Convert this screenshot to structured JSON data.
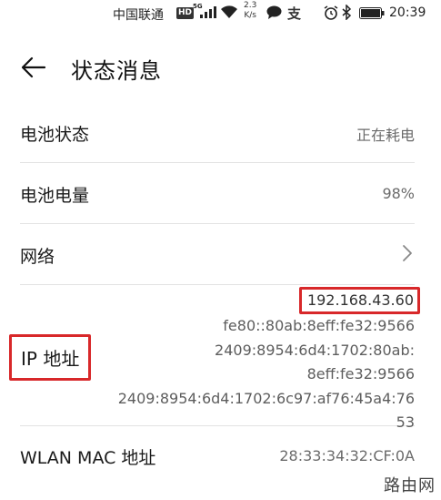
{
  "status_bar": {
    "carrier": "中国联通",
    "hd_badge": "HD",
    "network_gen": "5G",
    "speed_value": "2.3",
    "speed_unit": "K/s",
    "time": "20:39",
    "icons": [
      "signal-bars-icon",
      "wifi-icon",
      "message-bubble-icon",
      "alipay-icon",
      "alarm-icon",
      "bluetooth-icon",
      "battery-icon"
    ]
  },
  "header": {
    "title": "状态消息",
    "back_icon": "arrow-left-icon"
  },
  "rows": {
    "battery_status": {
      "label": "电池状态",
      "value": "正在耗电"
    },
    "battery_level": {
      "label": "电池电量",
      "value": "98%"
    },
    "network": {
      "label": "网络",
      "chevron_icon": "chevron-right-icon"
    },
    "ip": {
      "label": "IP 地址",
      "values": [
        "192.168.43.60",
        "fe80::80ab:8eff:fe32:9566",
        "2409:8954:6d4:1702:80ab:",
        "8eff:fe32:9566",
        "2409:8954:6d4:1702:6c97:af76:45a4:76",
        "53"
      ]
    },
    "wlan_mac": {
      "label": "WLAN MAC 地址",
      "value": "28:33:34:32:CF:0A"
    }
  },
  "watermark": "路由网",
  "colors": {
    "highlight_red": "#d8282a",
    "divider": "#e3e3e3",
    "value_gray": "#6b6b6b"
  }
}
